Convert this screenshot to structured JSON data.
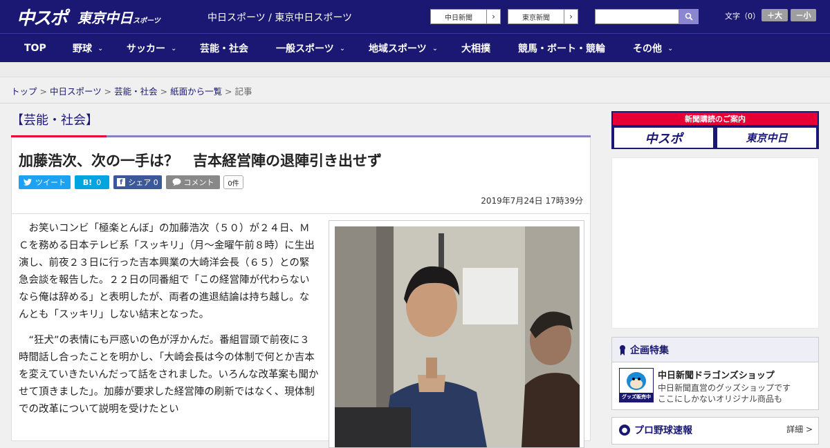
{
  "header": {
    "logo_chunichi": "中スポ",
    "logo_tokyo": "東京中日",
    "logo_tokyo_sub": "スポーツ",
    "site_name": "中日スポーツ / 東京中日スポーツ",
    "btn_chunichi": "中日新聞",
    "btn_tokyo": "東京新聞",
    "arrow": "›",
    "search_placeholder": "",
    "font_label": "文字（0）",
    "font_plus": "＋大",
    "font_minus": "－小"
  },
  "nav": {
    "items": [
      "TOP",
      "野球",
      "サッカー",
      "芸能・社会",
      "一般スポーツ",
      "地域スポーツ",
      "大相撲",
      "競馬・ボート・競輪",
      "その他"
    ],
    "chevron": "⌄"
  },
  "breadcrumb": {
    "items": [
      "トップ",
      "中日スポーツ",
      "芸能・社会",
      "紙面から一覧"
    ],
    "current": "記事",
    "sep": " > "
  },
  "article": {
    "category": "【芸能・社会】",
    "headline": "加藤浩次、次の一手は？　吉本経営陣の退陣引き出せず",
    "share": {
      "tweet": "ツイート",
      "hatena": "B!",
      "hatena_count": "0",
      "fb": "シェア",
      "fb_count": "0",
      "comment": "コメント",
      "count": "0件"
    },
    "date": "2019年7月24日 17時39分",
    "paragraphs": [
      "お笑いコンビ「極楽とんぼ」の加藤浩次（５０）が２４日、ＭＣを務める日本テレビ系「スッキリ」（月～金曜午前８時）に生出演し、前夜２３日に行った吉本興業の大崎洋会長（６５）との緊急会談を報告した。２２日の同番組で「この経営陣が代わらないなら俺は辞める」と表明したが、両者の進退結論は持ち越し。なんとも「スッキリ」しない結末となった。",
      "“狂犬”の表情にも戸惑いの色が浮かんだ。番組冒頭で前夜に３時間話し合ったことを明かし、「大崎会長は今の体制で何とか吉本を変えていきたいんだって話をされました。いろんな改革案も聞かせて頂きました」。加藤が要求した経営陣の刷新ではなく、現体制での改革について説明を受けたとい"
    ]
  },
  "sidebar": {
    "banner_label": "新聞購読のご案内",
    "banner_logo1": "中スポ",
    "banner_logo2": "東京中日",
    "kikaku_title": "企画特集",
    "shop_title": "中日新聞ドラゴンズショップ",
    "shop_desc1": "中日新聞直営のグッズショップです",
    "shop_desc2": "ここにしかないオリジナル商品も",
    "shop_icon_text": "グッズ販売中",
    "pro_title": "プロ野球速報",
    "pro_more": "詳細 >"
  },
  "colors": {
    "brand_navy": "#1a1872",
    "accent_red": "#e60033",
    "twitter": "#1da1f2",
    "hatena": "#00a4de",
    "facebook": "#3b5998",
    "comment": "#888888"
  }
}
